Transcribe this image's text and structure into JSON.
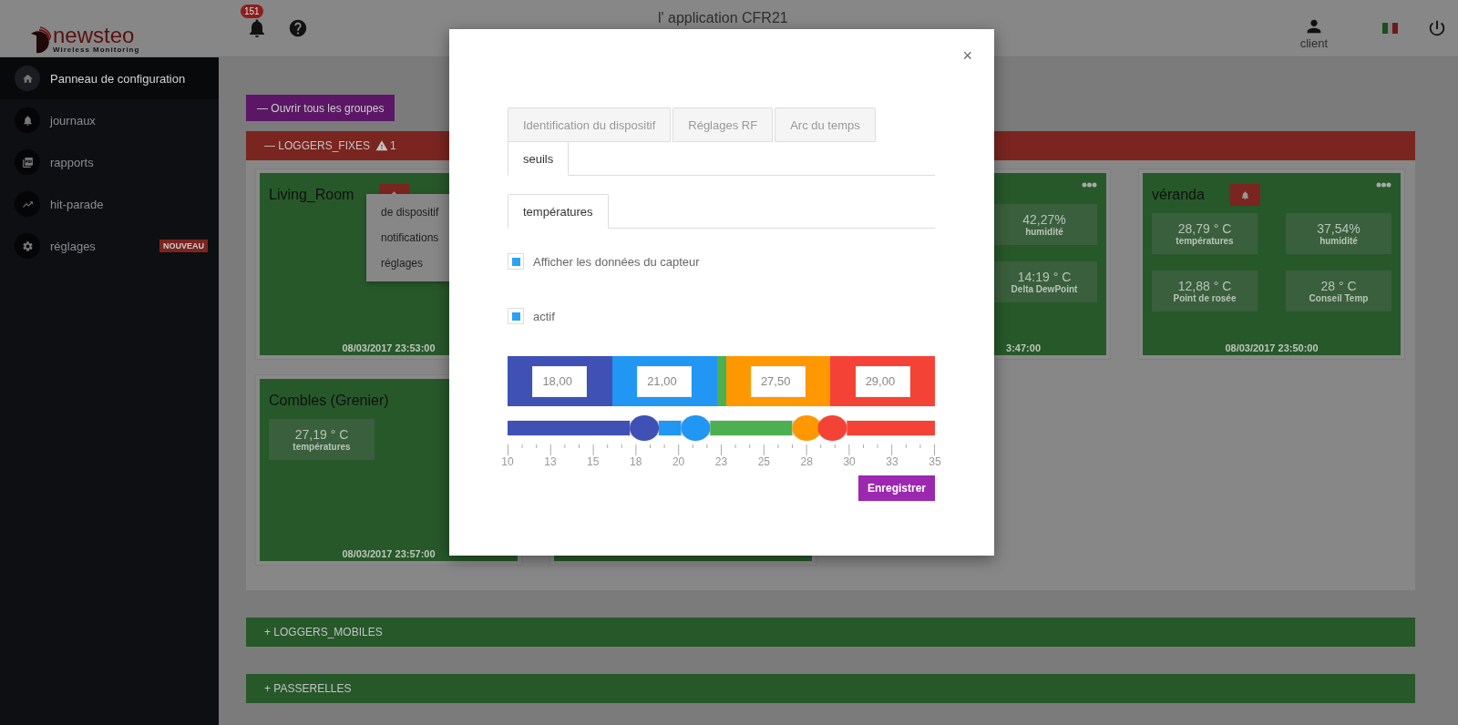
{
  "brand": {
    "name": "newsteo",
    "tagline": "Wireless Monitoring"
  },
  "header": {
    "title": "l' application CFR21",
    "notification_count": "151",
    "user": "client"
  },
  "sidebar": {
    "items": [
      {
        "label": "Panneau de configuration",
        "kind": "home",
        "selected": true
      },
      {
        "label": "journaux",
        "kind": "bell",
        "selected": false
      },
      {
        "label": "rapports",
        "kind": "report",
        "selected": false
      },
      {
        "label": "hit-parade",
        "kind": "trend",
        "selected": false
      },
      {
        "label": "réglages",
        "kind": "settings",
        "selected": false,
        "badge": "NOUVEAU"
      }
    ]
  },
  "open_all_button": "— Ouvrir tous les groupes",
  "groups": [
    {
      "title": "— LOGGERS_FIXES",
      "alert_count": "1",
      "color": "#7a2520",
      "expanded": true,
      "card_rows": [
        {
          "cards": [
            {
              "title": "Living_Room",
              "alarm": true,
              "date": "08/03/2017 23:53:00",
              "menu": [
                "de dispositif",
                "notifications",
                "réglages"
              ]
            },
            {
              "covered_left": true,
              "more": true,
              "metrics": [
                {
                  "value": "42,27%",
                  "label": "humidité"
                },
                {
                  "value": "14:19 ° C",
                  "label": "Delta DewPoint"
                }
              ],
              "date": "3:47:00"
            },
            {
              "title": "véranda",
              "alarm": true,
              "more": true,
              "metrics": [
                {
                  "value": "28,79 ° C",
                  "label": "températures"
                },
                {
                  "value": "37,54%",
                  "label": "humidité"
                },
                {
                  "value": "12,88 ° C",
                  "label": "Point de rosée"
                },
                {
                  "value": "28 ° C",
                  "label": "Conseil Temp"
                }
              ],
              "date": "08/03/2017 23:50:00"
            }
          ]
        },
        {
          "cards": [
            {
              "title": "Combles (Grenier)",
              "metrics": [
                {
                  "value": "27,19 ° C",
                  "label": "températures"
                }
              ],
              "date": "08/03/2017 23:57:00"
            }
          ]
        }
      ]
    },
    {
      "title": "+ LOGGERS_MOBILES",
      "color": "#27582a",
      "expanded": false
    },
    {
      "title": "+ PASSERELLES",
      "color": "#27582a",
      "expanded": false
    }
  ],
  "dialog": {
    "close": "×",
    "tabs": [
      {
        "label": "Identification du dispositif",
        "selected": false
      },
      {
        "label": "Réglages RF",
        "selected": false
      },
      {
        "label": "Arc du temps",
        "selected": false
      },
      {
        "label": "seuils",
        "selected": true
      }
    ],
    "subtabs": [
      {
        "label": "températures",
        "selected": true
      }
    ],
    "options": [
      {
        "label": "Afficher les données du capteur",
        "checked": true
      },
      {
        "label": "actif",
        "checked": true
      }
    ],
    "zones": [
      {
        "color": "#3f51b5",
        "value": "18,00"
      },
      {
        "color": "#2196f3",
        "value": "21,00"
      },
      {
        "color": "#4caf50"
      },
      {
        "color": "#ff9800",
        "value": "27,50"
      },
      {
        "color": "#f44336",
        "value": "29,00"
      }
    ],
    "handles": [
      {
        "level": 0.32,
        "color": "#3f51b5"
      },
      {
        "level": 0.44,
        "color": "#2196f3"
      },
      {
        "level": 0.7,
        "color": "#ff9800"
      },
      {
        "level": 0.76,
        "color": "#f44336"
      }
    ],
    "scale": [
      "10",
      "13",
      "15",
      "18",
      "20",
      "23",
      "25",
      "28",
      "30",
      "33",
      "35"
    ],
    "save_button": "Enregistrer"
  }
}
